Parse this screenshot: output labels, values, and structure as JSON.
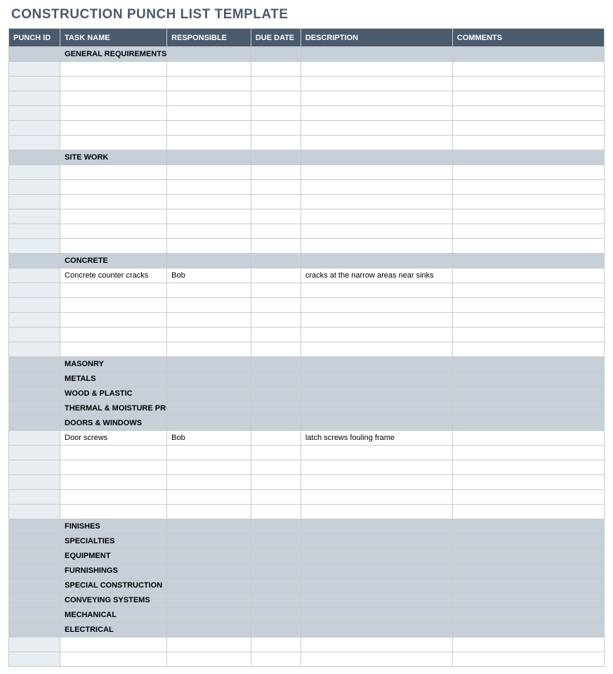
{
  "title": "CONSTRUCTION PUNCH LIST TEMPLATE",
  "columns": [
    "PUNCH ID",
    "TASK NAME",
    "RESPONSIBLE",
    "DUE DATE",
    "DESCRIPTION",
    "COMMENTS"
  ],
  "rows": [
    {
      "type": "section",
      "task": "GENERAL REQUIREMENTS"
    },
    {
      "type": "blank"
    },
    {
      "type": "blank"
    },
    {
      "type": "blank"
    },
    {
      "type": "blank"
    },
    {
      "type": "blank"
    },
    {
      "type": "blank"
    },
    {
      "type": "section",
      "task": "SITE WORK"
    },
    {
      "type": "blank"
    },
    {
      "type": "blank"
    },
    {
      "type": "blank"
    },
    {
      "type": "blank"
    },
    {
      "type": "blank"
    },
    {
      "type": "blank"
    },
    {
      "type": "section",
      "task": "CONCRETE"
    },
    {
      "type": "data",
      "id": "",
      "task": "Concrete counter cracks",
      "responsible": "Bob",
      "due": "",
      "description": "cracks at the narrow areas near sinks",
      "comments": ""
    },
    {
      "type": "blank"
    },
    {
      "type": "blank"
    },
    {
      "type": "blank"
    },
    {
      "type": "blank"
    },
    {
      "type": "blank"
    },
    {
      "type": "section",
      "task": "MASONRY"
    },
    {
      "type": "section",
      "task": "METALS"
    },
    {
      "type": "section",
      "task": "WOOD & PLASTIC"
    },
    {
      "type": "section",
      "task": "THERMAL & MOISTURE PROTECTION"
    },
    {
      "type": "section",
      "task": "DOORS & WINDOWS"
    },
    {
      "type": "data",
      "id": "",
      "task": "Door screws",
      "responsible": "Bob",
      "due": "",
      "description": "latch screws fouling frame",
      "comments": ""
    },
    {
      "type": "blank"
    },
    {
      "type": "blank"
    },
    {
      "type": "blank"
    },
    {
      "type": "blank"
    },
    {
      "type": "blank"
    },
    {
      "type": "section",
      "task": "FINISHES"
    },
    {
      "type": "section",
      "task": "SPECIALTIES"
    },
    {
      "type": "section",
      "task": "EQUIPMENT"
    },
    {
      "type": "section",
      "task": "FURNISHINGS"
    },
    {
      "type": "section",
      "task": "SPECIAL CONSTRUCTION"
    },
    {
      "type": "section",
      "task": "CONVEYING SYSTEMS"
    },
    {
      "type": "section",
      "task": "MECHANICAL"
    },
    {
      "type": "section",
      "task": "ELECTRICAL"
    },
    {
      "type": "blank"
    },
    {
      "type": "blank"
    }
  ]
}
